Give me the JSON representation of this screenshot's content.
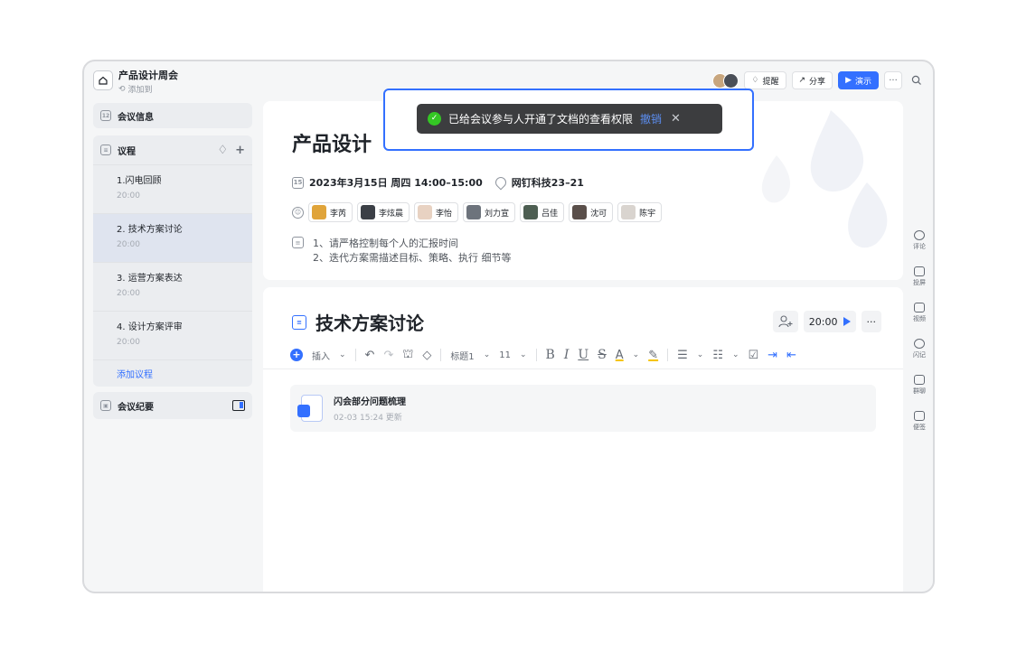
{
  "header": {
    "title": "产品设计周会",
    "add_to": "添加到",
    "remind": "提醒",
    "share": "分享",
    "present": "演示",
    "more": "···"
  },
  "sidebar": {
    "meeting_info": "会议信息",
    "agenda_title": "议程",
    "agenda_items": [
      {
        "title": "1.闪电回顾",
        "time": "20:00"
      },
      {
        "title": "2. 技术方案讨论",
        "time": "20:00"
      },
      {
        "title": "3. 运营方案表达",
        "time": "20:00"
      },
      {
        "title": "4. 设计方案评审",
        "time": "20:00"
      }
    ],
    "add_agenda": "添加议程",
    "minutes": "会议纪要"
  },
  "meeting": {
    "title": "产品设计",
    "datetime": "2023年3月15日 周四 14:00–15:00",
    "location": "网钉科技23–21",
    "participants": [
      "李芮",
      "李炫晨",
      "李怡",
      "刘力宣",
      "吕佳",
      "沈可",
      "陈宇"
    ],
    "notes": [
      "1、请严格控制每个人的汇报时间",
      "2、迭代方案需描述目标、策略、执行 细节等"
    ]
  },
  "section": {
    "title": "技术方案讨论",
    "timer": "20:00",
    "more": "···"
  },
  "toolbar": {
    "insert": "插入",
    "heading": "标题1",
    "font_size": "11"
  },
  "file": {
    "name": "闪会部分问题梳理",
    "meta": "02-03 15:24 更新"
  },
  "rail": [
    "评论",
    "投屏",
    "视频",
    "闪记",
    "群聊",
    "便签"
  ],
  "toast": {
    "message": "已给会议参与人开通了文档的查看权限",
    "undo": "撤销"
  },
  "colors": {
    "accent": "#3370ff",
    "success": "#34c724",
    "toast_bg": "#3c3d3f"
  }
}
